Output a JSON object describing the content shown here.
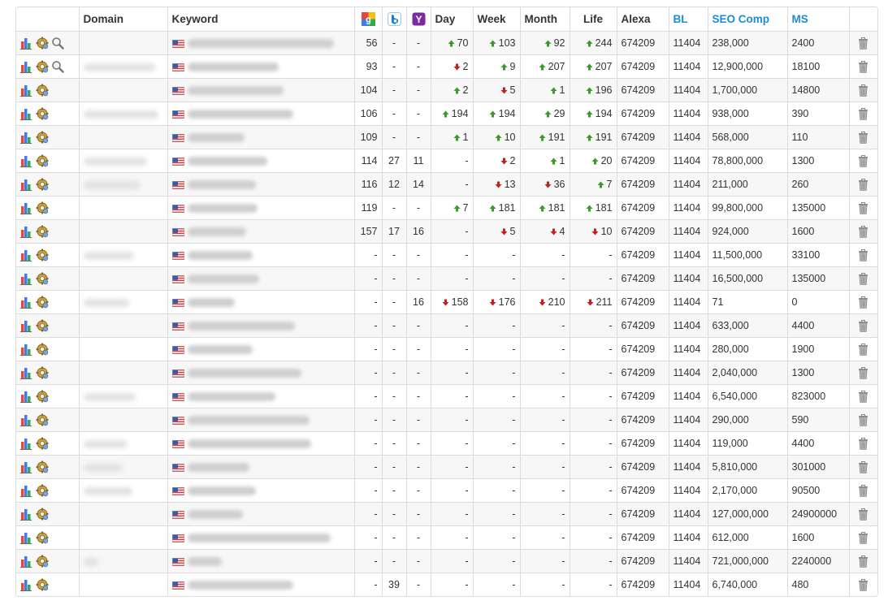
{
  "headers": {
    "domain": "Domain",
    "keyword": "Keyword",
    "day": "Day",
    "week": "Week",
    "month": "Month",
    "life": "Life",
    "alexa": "Alexa",
    "bl": "BL",
    "seo_comp": "SEO Comp",
    "ms": "MS"
  },
  "icons": {
    "google": "google-icon",
    "bing": "bing-icon",
    "yahoo": "yahoo-icon",
    "stats": "bar-chart-icon",
    "settings": "gear-icon",
    "search": "magnifier-icon",
    "flag": "us-flag-icon",
    "delete": "trash-icon",
    "up": "arrow-up-icon",
    "down": "arrow-down-icon"
  },
  "colors": {
    "header_link": "#1a8dd3",
    "up": "#3a9a2a",
    "down": "#c81e1e",
    "row_alt": "#f7f7f7",
    "border": "#dcdcdc"
  },
  "rows": [
    {
      "g": "56",
      "b": "-",
      "y": "-",
      "day": {
        "dir": "up",
        "v": "70"
      },
      "week": {
        "dir": "up",
        "v": "103"
      },
      "month": {
        "dir": "up",
        "v": "92"
      },
      "life": {
        "dir": "up",
        "v": "244"
      },
      "alexa": "674209",
      "bl": "11404",
      "seo": "238,000",
      "ms": "2400",
      "search": true
    },
    {
      "g": "93",
      "b": "-",
      "y": "-",
      "day": {
        "dir": "down",
        "v": "2"
      },
      "week": {
        "dir": "up",
        "v": "9"
      },
      "month": {
        "dir": "up",
        "v": "207"
      },
      "life": {
        "dir": "up",
        "v": "207"
      },
      "alexa": "674209",
      "bl": "11404",
      "seo": "12,900,000",
      "ms": "18100",
      "search": true
    },
    {
      "g": "104",
      "b": "-",
      "y": "-",
      "day": {
        "dir": "up",
        "v": "2"
      },
      "week": {
        "dir": "down",
        "v": "5"
      },
      "month": {
        "dir": "up",
        "v": "1"
      },
      "life": {
        "dir": "up",
        "v": "196"
      },
      "alexa": "674209",
      "bl": "11404",
      "seo": "1,700,000",
      "ms": "14800",
      "search": false
    },
    {
      "g": "106",
      "b": "-",
      "y": "-",
      "day": {
        "dir": "up",
        "v": "194"
      },
      "week": {
        "dir": "up",
        "v": "194"
      },
      "month": {
        "dir": "up",
        "v": "29"
      },
      "life": {
        "dir": "up",
        "v": "194"
      },
      "alexa": "674209",
      "bl": "11404",
      "seo": "938,000",
      "ms": "390",
      "search": false
    },
    {
      "g": "109",
      "b": "-",
      "y": "-",
      "day": {
        "dir": "up",
        "v": "1"
      },
      "week": {
        "dir": "up",
        "v": "10"
      },
      "month": {
        "dir": "up",
        "v": "191"
      },
      "life": {
        "dir": "up",
        "v": "191"
      },
      "alexa": "674209",
      "bl": "11404",
      "seo": "568,000",
      "ms": "110",
      "search": false
    },
    {
      "g": "114",
      "b": "27",
      "y": "11",
      "day": {
        "dir": "",
        "v": "-"
      },
      "week": {
        "dir": "down",
        "v": "2"
      },
      "month": {
        "dir": "up",
        "v": "1"
      },
      "life": {
        "dir": "up",
        "v": "20"
      },
      "alexa": "674209",
      "bl": "11404",
      "seo": "78,800,000",
      "ms": "1300",
      "search": false
    },
    {
      "g": "116",
      "b": "12",
      "y": "14",
      "day": {
        "dir": "",
        "v": "-"
      },
      "week": {
        "dir": "down",
        "v": "13"
      },
      "month": {
        "dir": "down",
        "v": "36"
      },
      "life": {
        "dir": "up",
        "v": "7"
      },
      "alexa": "674209",
      "bl": "11404",
      "seo": "211,000",
      "ms": "260",
      "search": false
    },
    {
      "g": "119",
      "b": "-",
      "y": "-",
      "day": {
        "dir": "up",
        "v": "7"
      },
      "week": {
        "dir": "up",
        "v": "181"
      },
      "month": {
        "dir": "up",
        "v": "181"
      },
      "life": {
        "dir": "up",
        "v": "181"
      },
      "alexa": "674209",
      "bl": "11404",
      "seo": "99,800,000",
      "ms": "135000",
      "search": false
    },
    {
      "g": "157",
      "b": "17",
      "y": "16",
      "day": {
        "dir": "",
        "v": "-"
      },
      "week": {
        "dir": "down",
        "v": "5"
      },
      "month": {
        "dir": "down",
        "v": "4"
      },
      "life": {
        "dir": "down",
        "v": "10"
      },
      "alexa": "674209",
      "bl": "11404",
      "seo": "924,000",
      "ms": "1600",
      "search": false
    },
    {
      "g": "-",
      "b": "-",
      "y": "-",
      "day": {
        "dir": "",
        "v": "-"
      },
      "week": {
        "dir": "",
        "v": "-"
      },
      "month": {
        "dir": "",
        "v": "-"
      },
      "life": {
        "dir": "",
        "v": "-"
      },
      "alexa": "674209",
      "bl": "11404",
      "seo": "11,500,000",
      "ms": "33100",
      "search": false
    },
    {
      "g": "-",
      "b": "-",
      "y": "-",
      "day": {
        "dir": "",
        "v": "-"
      },
      "week": {
        "dir": "",
        "v": "-"
      },
      "month": {
        "dir": "",
        "v": "-"
      },
      "life": {
        "dir": "",
        "v": "-"
      },
      "alexa": "674209",
      "bl": "11404",
      "seo": "16,500,000",
      "ms": "135000",
      "search": false
    },
    {
      "g": "-",
      "b": "-",
      "y": "16",
      "day": {
        "dir": "down",
        "v": "158"
      },
      "week": {
        "dir": "down",
        "v": "176"
      },
      "month": {
        "dir": "down",
        "v": "210"
      },
      "life": {
        "dir": "down",
        "v": "211"
      },
      "alexa": "674209",
      "bl": "11404",
      "seo": "71",
      "ms": "0",
      "search": false
    },
    {
      "g": "-",
      "b": "-",
      "y": "-",
      "day": {
        "dir": "",
        "v": "-"
      },
      "week": {
        "dir": "",
        "v": "-"
      },
      "month": {
        "dir": "",
        "v": "-"
      },
      "life": {
        "dir": "",
        "v": "-"
      },
      "alexa": "674209",
      "bl": "11404",
      "seo": "633,000",
      "ms": "4400",
      "search": false
    },
    {
      "g": "-",
      "b": "-",
      "y": "-",
      "day": {
        "dir": "",
        "v": "-"
      },
      "week": {
        "dir": "",
        "v": "-"
      },
      "month": {
        "dir": "",
        "v": "-"
      },
      "life": {
        "dir": "",
        "v": "-"
      },
      "alexa": "674209",
      "bl": "11404",
      "seo": "280,000",
      "ms": "1900",
      "search": false
    },
    {
      "g": "-",
      "b": "-",
      "y": "-",
      "day": {
        "dir": "",
        "v": "-"
      },
      "week": {
        "dir": "",
        "v": "-"
      },
      "month": {
        "dir": "",
        "v": "-"
      },
      "life": {
        "dir": "",
        "v": "-"
      },
      "alexa": "674209",
      "bl": "11404",
      "seo": "2,040,000",
      "ms": "1300",
      "search": false
    },
    {
      "g": "-",
      "b": "-",
      "y": "-",
      "day": {
        "dir": "",
        "v": "-"
      },
      "week": {
        "dir": "",
        "v": "-"
      },
      "month": {
        "dir": "",
        "v": "-"
      },
      "life": {
        "dir": "",
        "v": "-"
      },
      "alexa": "674209",
      "bl": "11404",
      "seo": "6,540,000",
      "ms": "823000",
      "search": false
    },
    {
      "g": "-",
      "b": "-",
      "y": "-",
      "day": {
        "dir": "",
        "v": "-"
      },
      "week": {
        "dir": "",
        "v": "-"
      },
      "month": {
        "dir": "",
        "v": "-"
      },
      "life": {
        "dir": "",
        "v": "-"
      },
      "alexa": "674209",
      "bl": "11404",
      "seo": "290,000",
      "ms": "590",
      "search": false
    },
    {
      "g": "-",
      "b": "-",
      "y": "-",
      "day": {
        "dir": "",
        "v": "-"
      },
      "week": {
        "dir": "",
        "v": "-"
      },
      "month": {
        "dir": "",
        "v": "-"
      },
      "life": {
        "dir": "",
        "v": "-"
      },
      "alexa": "674209",
      "bl": "11404",
      "seo": "119,000",
      "ms": "4400",
      "search": false
    },
    {
      "g": "-",
      "b": "-",
      "y": "-",
      "day": {
        "dir": "",
        "v": "-"
      },
      "week": {
        "dir": "",
        "v": "-"
      },
      "month": {
        "dir": "",
        "v": "-"
      },
      "life": {
        "dir": "",
        "v": "-"
      },
      "alexa": "674209",
      "bl": "11404",
      "seo": "5,810,000",
      "ms": "301000",
      "search": false
    },
    {
      "g": "-",
      "b": "-",
      "y": "-",
      "day": {
        "dir": "",
        "v": "-"
      },
      "week": {
        "dir": "",
        "v": "-"
      },
      "month": {
        "dir": "",
        "v": "-"
      },
      "life": {
        "dir": "",
        "v": "-"
      },
      "alexa": "674209",
      "bl": "11404",
      "seo": "2,170,000",
      "ms": "90500",
      "search": false
    },
    {
      "g": "-",
      "b": "-",
      "y": "-",
      "day": {
        "dir": "",
        "v": "-"
      },
      "week": {
        "dir": "",
        "v": "-"
      },
      "month": {
        "dir": "",
        "v": "-"
      },
      "life": {
        "dir": "",
        "v": "-"
      },
      "alexa": "674209",
      "bl": "11404",
      "seo": "127,000,000",
      "ms": "24900000",
      "search": false
    },
    {
      "g": "-",
      "b": "-",
      "y": "-",
      "day": {
        "dir": "",
        "v": "-"
      },
      "week": {
        "dir": "",
        "v": "-"
      },
      "month": {
        "dir": "",
        "v": "-"
      },
      "life": {
        "dir": "",
        "v": "-"
      },
      "alexa": "674209",
      "bl": "11404",
      "seo": "612,000",
      "ms": "1600",
      "search": false
    },
    {
      "g": "-",
      "b": "-",
      "y": "-",
      "day": {
        "dir": "",
        "v": "-"
      },
      "week": {
        "dir": "",
        "v": "-"
      },
      "month": {
        "dir": "",
        "v": "-"
      },
      "life": {
        "dir": "",
        "v": "-"
      },
      "alexa": "674209",
      "bl": "11404",
      "seo": "721,000,000",
      "ms": "2240000",
      "search": false
    },
    {
      "g": "-",
      "b": "39",
      "y": "-",
      "day": {
        "dir": "",
        "v": "-"
      },
      "week": {
        "dir": "",
        "v": "-"
      },
      "month": {
        "dir": "",
        "v": "-"
      },
      "life": {
        "dir": "",
        "v": "-"
      },
      "alexa": "674209",
      "bl": "11404",
      "seo": "6,740,000",
      "ms": "480",
      "search": false
    }
  ]
}
